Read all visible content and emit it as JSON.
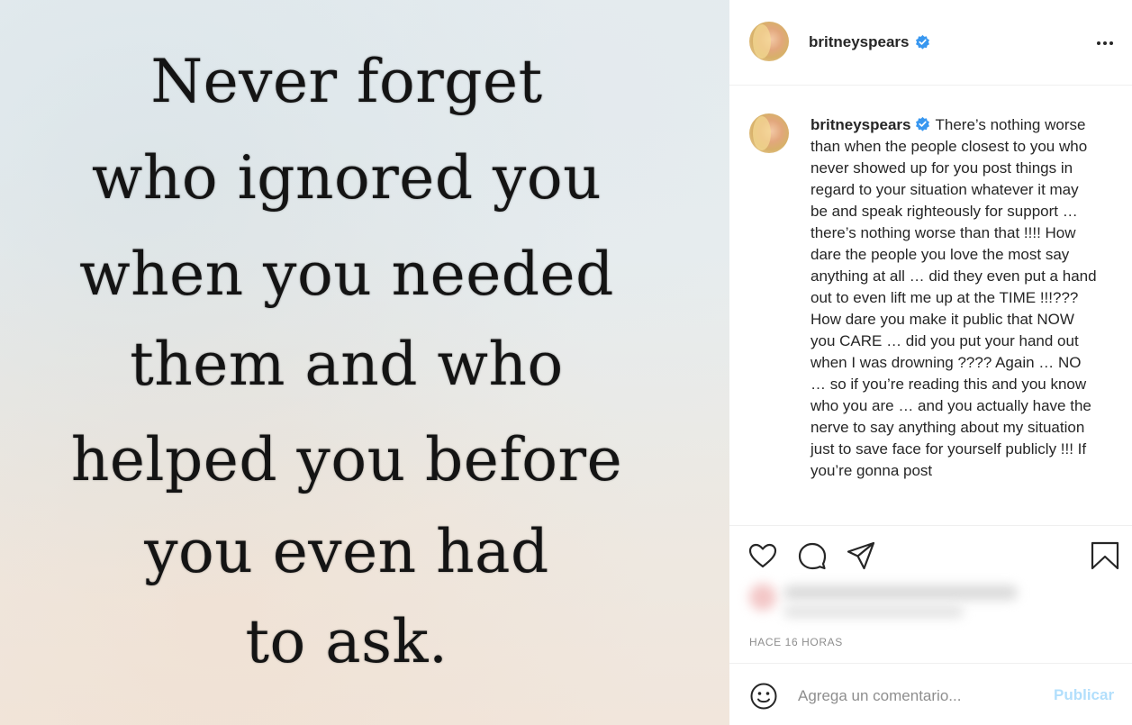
{
  "post_image": {
    "quote_lines": [
      "Never forget",
      "who ignored you",
      "when you needed",
      "them and who",
      "helped you before",
      "you even had",
      "to ask."
    ]
  },
  "header": {
    "username": "britneyspears",
    "verified": true,
    "more_icon": "more-horizontal-icon"
  },
  "caption": {
    "username": "britneyspears",
    "text": "There’s nothing worse than when the people closest to you who never showed up for you post things in regard to your situation whatever it may be and speak righteously for support … there’s nothing worse than that !!!! How dare the people you love the most say anything at all … did they even put a hand out to even lift me up at the TIME !!!??? How dare you make it public that NOW you CARE … did you put your hand out when I was drowning ???? Again … NO … so if you’re reading this and you know who you are … and you actually have the nerve to say anything about my situation just to save face for yourself publicly !!! If you’re gonna post"
  },
  "actions": {
    "icons": [
      "heart-icon",
      "comment-icon",
      "share-icon",
      "bookmark-icon"
    ],
    "timestamp": "HACE 16 HORAS"
  },
  "comment_box": {
    "placeholder": "Agrega un comentario...",
    "publish_label": "Publicar"
  },
  "colors": {
    "verified_blue": "#3897f0",
    "publish_disabled": "#b2dffc",
    "muted_text": "#8e8e8e",
    "divider": "#efefef"
  }
}
